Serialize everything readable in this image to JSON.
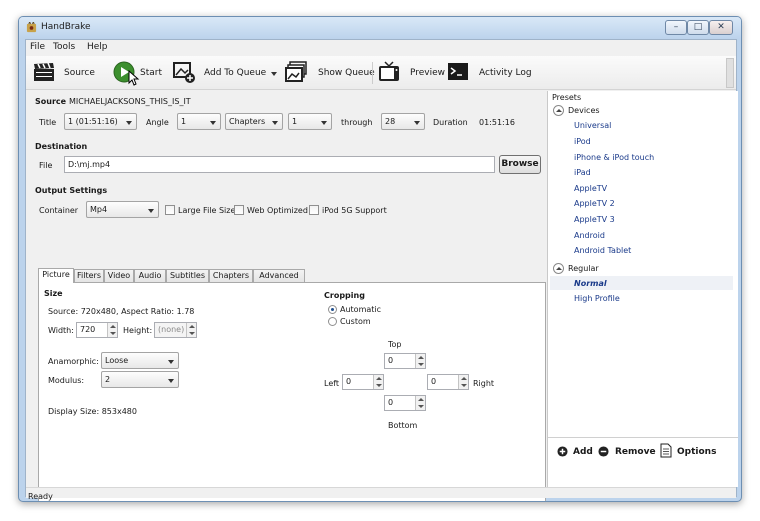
{
  "window": {
    "title": "HandBrake"
  },
  "menu": [
    "File",
    "Tools",
    "Help"
  ],
  "toolbar": {
    "source": "Source",
    "start": "Start",
    "add_to_queue": "Add To Queue",
    "show_queue": "Show Queue",
    "preview": "Preview",
    "activity_log": "Activity Log"
  },
  "source": {
    "heading": "Source",
    "name": "MICHAELJACKSONS_THIS_IS_IT",
    "title_label": "Title",
    "title_value": "1 (01:51:16)",
    "angle_label": "Angle",
    "angle_value": "1",
    "range_type": "Chapters",
    "range_start": "1",
    "through_label": "through",
    "range_end": "28",
    "duration_label": "Duration",
    "duration_value": "01:51:16"
  },
  "destination": {
    "heading": "Destination",
    "file_label": "File",
    "file_value": "D:\\mj.mp4",
    "browse_label": "Browse"
  },
  "output": {
    "heading": "Output Settings",
    "container_label": "Container",
    "container_value": "Mp4",
    "large_file": "Large File Size",
    "web_optimized": "Web Optimized",
    "ipod_5g": "iPod 5G Support"
  },
  "tabs": [
    "Picture",
    "Filters",
    "Video",
    "Audio",
    "Subtitles",
    "Chapters",
    "Advanced"
  ],
  "picture": {
    "size_heading": "Size",
    "source_info": "Source:  720x480, Aspect Ratio: 1.78",
    "width_label": "Width:",
    "width_value": "720",
    "height_label": "Height:",
    "height_value": "(none)",
    "anamorphic_label": "Anamorphic:",
    "anamorphic_value": "Loose",
    "modulus_label": "Modulus:",
    "modulus_value": "2",
    "display_size": "Display Size:   853x480",
    "cropping_heading": "Cropping",
    "crop_automatic": "Automatic",
    "crop_custom": "Custom",
    "top_label": "Top",
    "left_label": "Left",
    "right_label": "Right",
    "bottom_label": "Bottom",
    "crop_top": "0",
    "crop_left": "0",
    "crop_right": "0",
    "crop_bottom": "0"
  },
  "presets": {
    "title": "Presets",
    "groups": [
      {
        "name": "Devices",
        "items": [
          "Universal",
          "iPod",
          "iPhone & iPod touch",
          "iPad",
          "AppleTV",
          "AppleTV 2",
          "AppleTV 3",
          "Android",
          "Android Tablet"
        ]
      },
      {
        "name": "Regular",
        "items": [
          "Normal",
          "High Profile"
        ]
      }
    ],
    "add_label": "Add",
    "remove_label": "Remove",
    "options_label": "Options"
  },
  "status": {
    "text": "Ready"
  }
}
